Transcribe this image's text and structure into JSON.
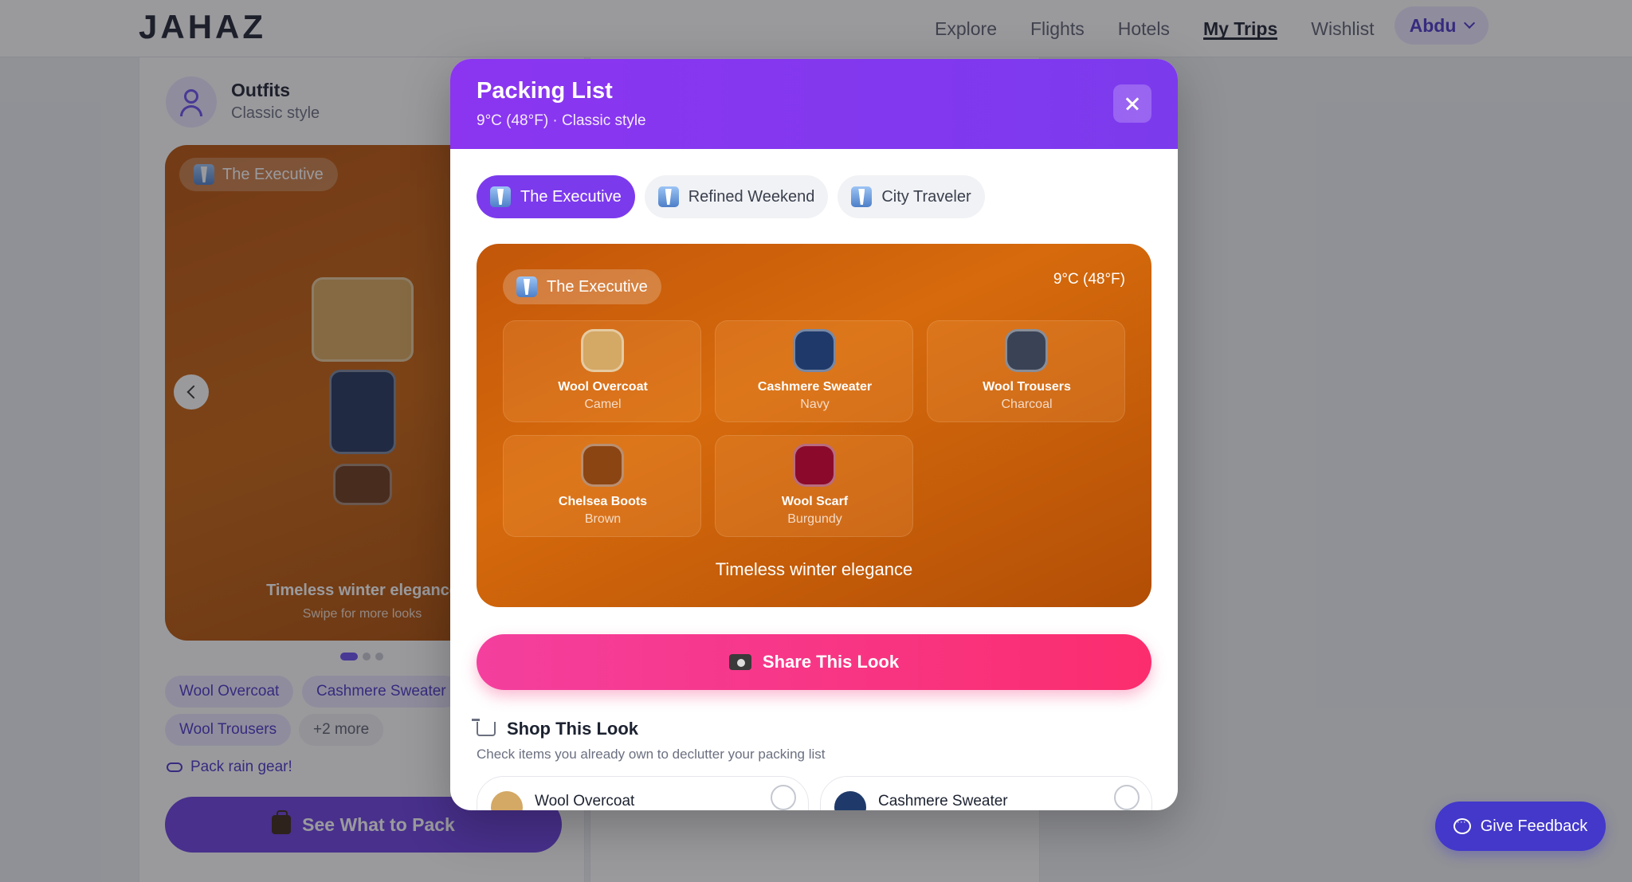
{
  "app": {
    "logo": "JAHAZ",
    "nav": [
      "Explore",
      "Flights",
      "Hotels",
      "My Trips",
      "Wishlist"
    ],
    "active_nav": "My Trips",
    "user": "Abdu"
  },
  "background": {
    "title": "Outfits",
    "subtitle": "Classic style",
    "carousel": {
      "pill": "The Executive",
      "tagline": "Timeless winter elegance",
      "hint": "Swipe for more looks"
    },
    "chips": [
      "Wool Overcoat",
      "Cashmere Sweater",
      "Wool Trousers",
      "+2 more"
    ],
    "rain_tip": "Pack rain gear!",
    "pack_button": "See What to Pack"
  },
  "modal": {
    "title": "Packing List",
    "subtitle": "9°C (48°F) · Classic style",
    "tabs": [
      "The Executive",
      "Refined Weekend",
      "City Traveler"
    ],
    "active_tab": "The Executive",
    "look": {
      "name": "The Executive",
      "temperature": "9°C (48°F)",
      "tagline": "Timeless winter elegance",
      "items": [
        {
          "name": "Wool Overcoat",
          "color": "Camel",
          "swatch": "#d4a865"
        },
        {
          "name": "Cashmere Sweater",
          "color": "Navy",
          "swatch": "#1f3a6a"
        },
        {
          "name": "Wool Trousers",
          "color": "Charcoal",
          "swatch": "#3a4356"
        },
        {
          "name": "Chelsea Boots",
          "color": "Brown",
          "swatch": "#8b4513"
        },
        {
          "name": "Wool Scarf",
          "color": "Burgundy",
          "swatch": "#8b0a2b"
        }
      ]
    },
    "share_button": "Share This Look",
    "shop": {
      "title": "Shop This Look",
      "subtitle": "Check items you already own to declutter your packing list",
      "items": [
        {
          "name": "Wool Overcoat",
          "swatch": "#d4a865"
        },
        {
          "name": "Cashmere Sweater",
          "swatch": "#1f3a6a"
        }
      ]
    }
  },
  "feedback_button": "Give Feedback",
  "colors": {
    "primary": "#7c3aed",
    "share_gradient_start": "#f43f9e",
    "share_gradient_end": "#fb2d6e",
    "hero": "#c9620c"
  }
}
